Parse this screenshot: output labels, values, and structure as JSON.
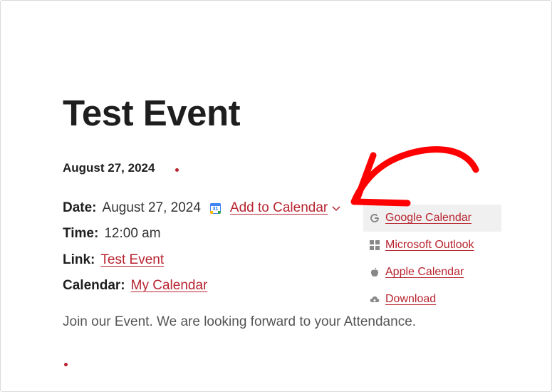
{
  "event": {
    "title": "Test Event",
    "date_heading": "August 27, 2024",
    "date_label": "Date:",
    "date_value": "August 27, 2024",
    "calendar_icon_number": "31",
    "add_to_calendar": "Add to Calendar",
    "time_label": "Time:",
    "time_value": "12:00 am",
    "link_label": "Link:",
    "link_value": "Test Event",
    "calendar_label": "Calendar:",
    "calendar_value": "My Calendar",
    "description": "Join our Event. We are looking forward to your Attendance."
  },
  "dropdown": {
    "items": [
      {
        "label": "Google Calendar",
        "icon": "google-icon",
        "active": true
      },
      {
        "label": "Microsoft Outlook",
        "icon": "windows-icon",
        "active": false
      },
      {
        "label": "Apple Calendar",
        "icon": "apple-icon",
        "active": false
      },
      {
        "label": "Download",
        "icon": "cloud-download-icon",
        "active": false
      }
    ]
  },
  "colors": {
    "accent": "#b8232f",
    "arrow": "#ff0000",
    "title": "#1e1e1e",
    "description": "#555555",
    "dropdown_active_bg": "#f0f0f0"
  }
}
